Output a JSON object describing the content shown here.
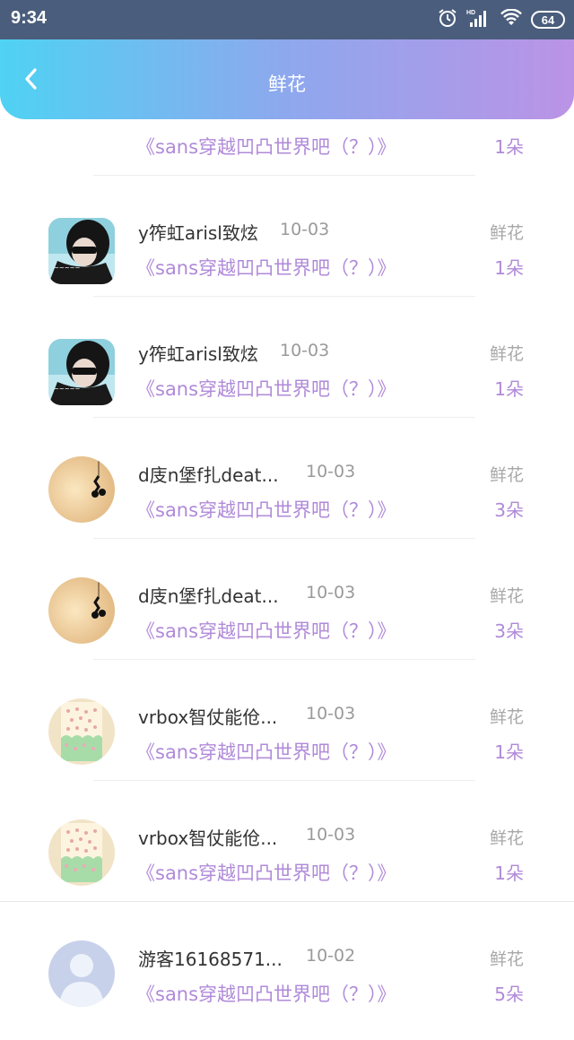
{
  "status_bar": {
    "time": "9:34",
    "battery": "64",
    "icons": [
      "alarm-icon",
      "hd-signal-icon",
      "wifi-icon",
      "battery-icon"
    ]
  },
  "header": {
    "title": "鲜花",
    "gradient": [
      "#4fd2f3",
      "#8ea8ee",
      "#bb93e6"
    ]
  },
  "partial_row": {
    "book": "《sans穿越凹凸世界吧（？）》",
    "count": "1朵"
  },
  "rows": [
    {
      "name": "y筰虹arisl致炫",
      "date": "10-03",
      "book": "《sans穿越凹凸世界吧（？）》",
      "type": "鲜花",
      "count": "1朵",
      "avatar": "dark-photo"
    },
    {
      "name": "y筰虹arisl致炫",
      "date": "10-03",
      "book": "《sans穿越凹凸世界吧（？）》",
      "type": "鲜花",
      "count": "1朵",
      "avatar": "dark-photo"
    },
    {
      "name": "d庋n堡f扎deat...",
      "date": "10-03",
      "book": "《sans穿越凹凸世界吧（？）》",
      "type": "鲜花",
      "count": "3朵",
      "avatar": "music-note"
    },
    {
      "name": "d庋n堡f扎deat...",
      "date": "10-03",
      "book": "《sans穿越凹凸世界吧（？）》",
      "type": "鲜花",
      "count": "3朵",
      "avatar": "music-note"
    },
    {
      "name": "vrbox智仗能伧...",
      "date": "10-03",
      "book": "《sans穿越凹凸世界吧（？）》",
      "type": "鲜花",
      "count": "1朵",
      "avatar": "polka-cake"
    },
    {
      "name": "vrbox智仗能伧...",
      "date": "10-03",
      "book": "《sans穿越凹凸世界吧（？）》",
      "type": "鲜花",
      "count": "1朵",
      "avatar": "polka-cake"
    },
    {
      "name": "游客16168571...",
      "date": "10-02",
      "book": "《sans穿越凹凸世界吧（？）》",
      "type": "鲜花",
      "count": "5朵",
      "avatar": "default-user"
    }
  ],
  "colors": {
    "accent": "#b08ad9",
    "status_bar": "#4a5d7c"
  }
}
